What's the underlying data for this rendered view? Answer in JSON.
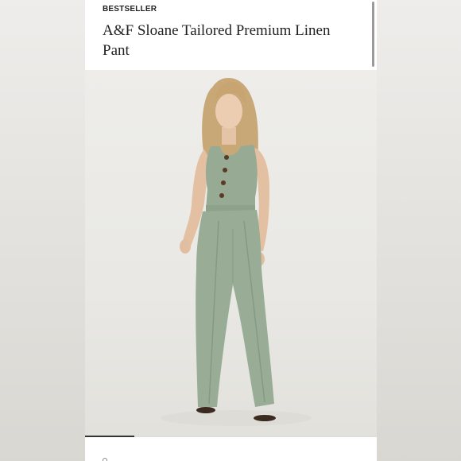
{
  "product": {
    "badge": "BESTSELLER",
    "title": "A&F Sloane Tailored Premium Linen Pant"
  },
  "gallery": {
    "progress_fraction": 0.17
  },
  "colors": {
    "outfit": "#97aa94",
    "background": "#e9e8e4"
  }
}
